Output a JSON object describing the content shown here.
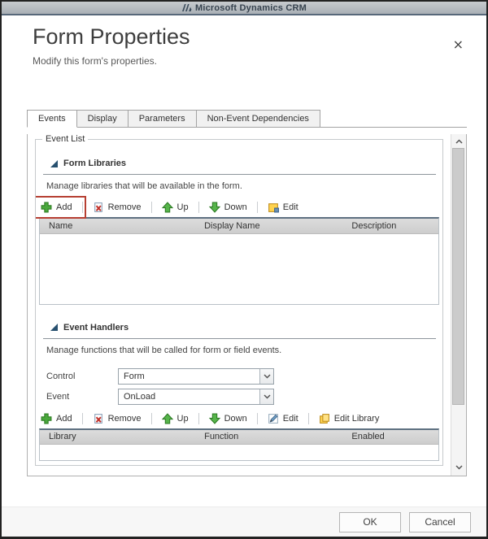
{
  "titlebar": {
    "app_name": "Microsoft Dynamics CRM"
  },
  "header": {
    "title": "Form Properties",
    "subtitle": "Modify this form's properties."
  },
  "icons": {
    "close": "×"
  },
  "tabs": [
    {
      "label": "Events",
      "active": true
    },
    {
      "label": "Display",
      "active": false
    },
    {
      "label": "Parameters",
      "active": false
    },
    {
      "label": "Non-Event Dependencies",
      "active": false
    }
  ],
  "event_list": {
    "legend": "Event List",
    "form_libraries": {
      "title": "Form Libraries",
      "description": "Manage libraries that will be available in the form.",
      "toolbar": [
        "Add",
        "Remove",
        "Up",
        "Down",
        "Edit"
      ],
      "columns": [
        "Name",
        "Display Name",
        "Description"
      ],
      "rows": []
    },
    "event_handlers": {
      "title": "Event Handlers",
      "description": "Manage functions that will be called for form or field events.",
      "control_label": "Control",
      "control_value": "Form",
      "event_label": "Event",
      "event_value": "OnLoad",
      "toolbar": [
        "Add",
        "Remove",
        "Up",
        "Down",
        "Edit",
        "Edit Library"
      ],
      "columns": [
        "Library",
        "Function",
        "Enabled"
      ],
      "rows": []
    }
  },
  "highlight": {
    "target": "Add button",
    "color": "#b63f32"
  },
  "footer": {
    "ok_label": "OK",
    "cancel_label": "Cancel"
  },
  "colors": {
    "accent_red": "#b63f32",
    "icon_green": "#4aa83c",
    "triangle_navy": "#27506f",
    "titlebar_border": "#57687a"
  }
}
